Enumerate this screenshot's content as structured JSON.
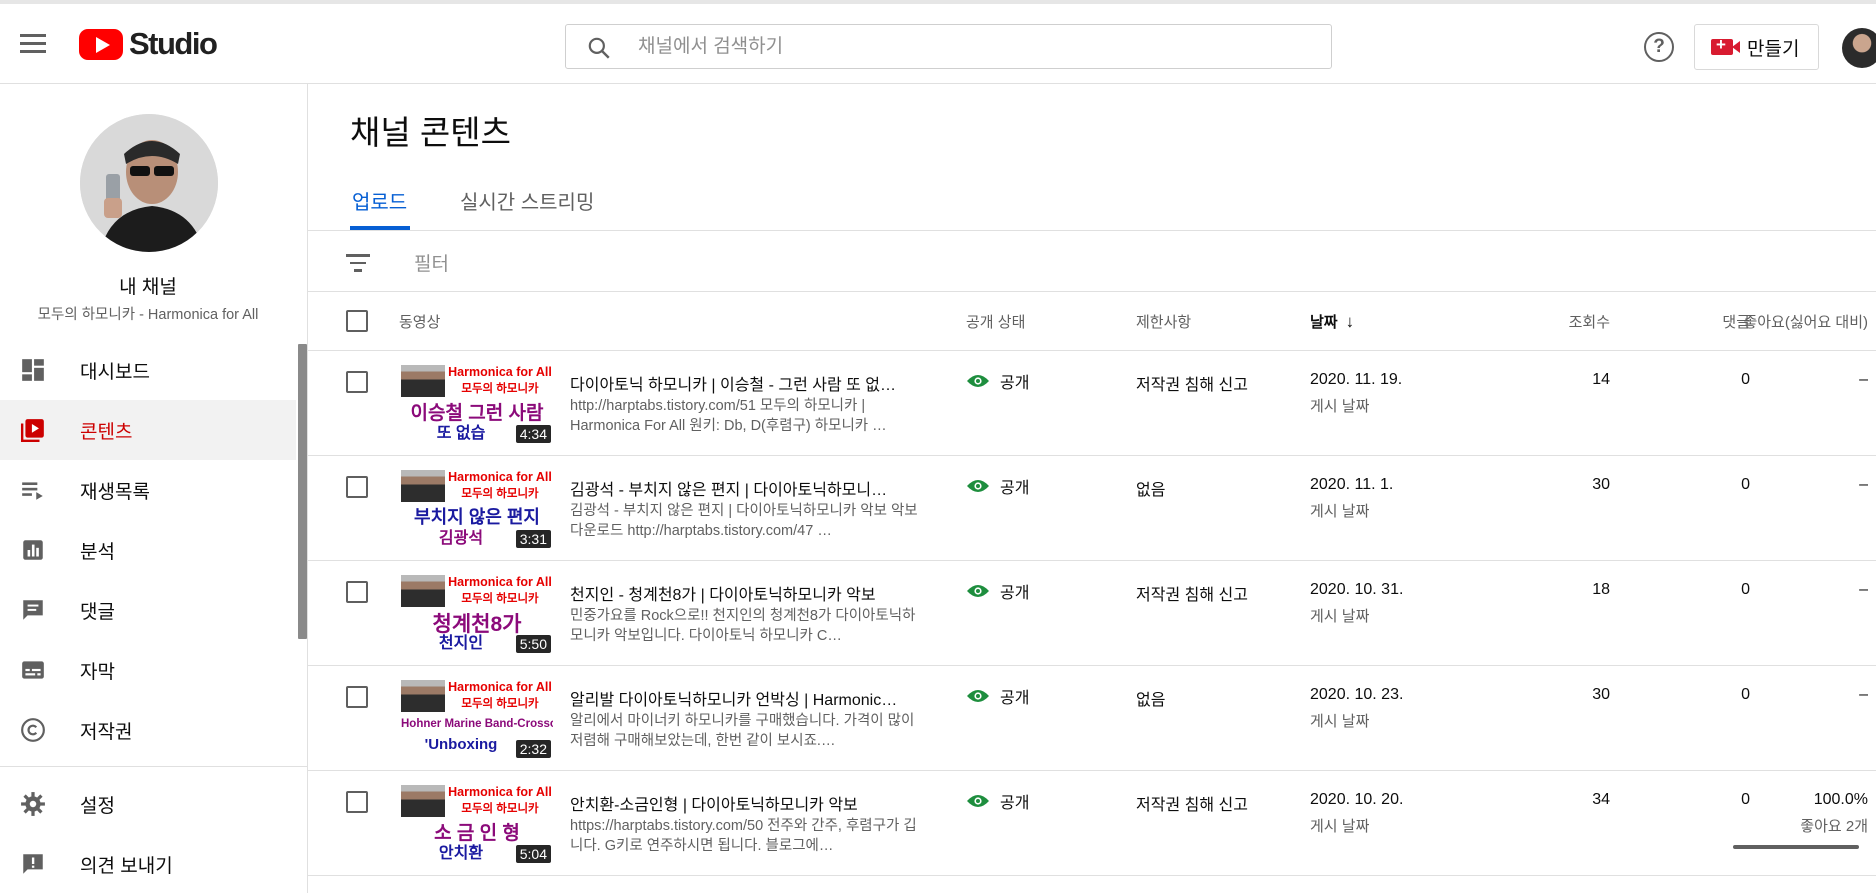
{
  "header": {
    "logo_text": "Studio",
    "search_placeholder": "채널에서 검색하기",
    "create_label": "만들기"
  },
  "sidebar": {
    "channel_title": "내 채널",
    "channel_name": "모두의 하모니카 - Harmonica for All",
    "items": [
      {
        "label": "대시보드",
        "icon": "dashboard-icon"
      },
      {
        "label": "콘텐츠",
        "icon": "content-icon",
        "active": true
      },
      {
        "label": "재생목록",
        "icon": "playlist-icon"
      },
      {
        "label": "분석",
        "icon": "analytics-icon"
      },
      {
        "label": "댓글",
        "icon": "comments-icon"
      },
      {
        "label": "자막",
        "icon": "subtitles-icon"
      },
      {
        "label": "저작권",
        "icon": "copyright-icon"
      },
      {
        "label": "설정",
        "icon": "gear-icon"
      },
      {
        "label": "의견 보내기",
        "icon": "feedback-icon"
      }
    ]
  },
  "main": {
    "title": "채널 콘텐츠",
    "tabs": [
      "업로드",
      "실시간 스트리밍"
    ],
    "filter_label": "필터",
    "columns": {
      "video": "동영상",
      "visibility": "공개 상태",
      "restrictions": "제한사항",
      "date": "날짜",
      "views": "조회수",
      "comments": "댓글",
      "likes": "좋아요(싫어요 대비)"
    },
    "rows": [
      {
        "thumb_line1": "Harmonica for All",
        "thumb_line2": "모두의 하모니카",
        "thumb_big1": "이승철 그런 사람",
        "thumb_big2": "또 없습",
        "duration": "4:34",
        "title": "다이아토닉 하모니카 | 이승철 - 그런 사람 또 없…",
        "description": "http://harptabs.tistory.com/51 모두의 하모니카 | Harmonica For All 원키: Db, D(후렴구) 하모니카 …",
        "visibility": "공개",
        "restriction": "저작권 침해 신고",
        "date": "2020. 11. 19.",
        "date_label": "게시 날짜",
        "views": "14",
        "comments": "0",
        "likes": "–",
        "likes_sub": ""
      },
      {
        "thumb_line1": "Harmonica for All",
        "thumb_line2": "모두의 하모니카",
        "thumb_big1": "부치지 않은 편지",
        "thumb_big2": "김광석",
        "duration": "3:31",
        "title": "김광석 - 부치지 않은 편지 | 다이아토닉하모니…",
        "description": "김광석 - 부치지 않은 편지 | 다이아토닉하모니카 악보 악보 다운로드 http://harptabs.tistory.com/47 …",
        "visibility": "공개",
        "restriction": "없음",
        "date": "2020. 11. 1.",
        "date_label": "게시 날짜",
        "views": "30",
        "comments": "0",
        "likes": "–",
        "likes_sub": ""
      },
      {
        "thumb_line1": "Harmonica for All",
        "thumb_line2": "모두의 하모니카",
        "thumb_big1": "청계천8가",
        "thumb_big2": "천지인",
        "duration": "5:50",
        "title": "천지인 - 청계천8가 | 다이아토닉하모니카 악보",
        "description": "민중가요를 Rock으로!! 천지인의 청계천8가 다이아토닉하모니카 악보입니다. 다이아토닉 하모니카 C…",
        "visibility": "공개",
        "restriction": "저작권 침해 신고",
        "date": "2020. 10. 31.",
        "date_label": "게시 날짜",
        "views": "18",
        "comments": "0",
        "likes": "–",
        "likes_sub": ""
      },
      {
        "thumb_line1": "Harmonica for All",
        "thumb_line2": "모두의 하모니카",
        "thumb_big1": "Hohner Marine Band-Crossover",
        "thumb_big2": "'Unboxing",
        "duration": "2:32",
        "title": "알리발 다이아토닉하모니카 언박싱 | Harmonic…",
        "description": "알리에서 마이너키 하모니카를 구매했습니다. 가격이 많이 저렴해 구매해보았는데, 한번 같이 보시죠.…",
        "visibility": "공개",
        "restriction": "없음",
        "date": "2020. 10. 23.",
        "date_label": "게시 날짜",
        "views": "30",
        "comments": "0",
        "likes": "–",
        "likes_sub": ""
      },
      {
        "thumb_line1": "Harmonica for All",
        "thumb_line2": "모두의 하모니카",
        "thumb_big1": "소 금 인 형",
        "thumb_big2": "안치환",
        "duration": "5:04",
        "title": "안치환-소금인형 | 다이아토닉하모니카 악보",
        "description": "https://harptabs.tistory.com/50 전주와 간주, 후렴구가 깁니다. G키로 연주하시면 됩니다. 블로그에…",
        "visibility": "공개",
        "restriction": "저작권 침해 신고",
        "date": "2020. 10. 20.",
        "date_label": "게시 날짜",
        "views": "34",
        "comments": "0",
        "likes": "100.0%",
        "likes_sub": "좋아요 2개",
        "like_ratio": 1.0
      }
    ]
  },
  "colors": {
    "accent": "#065fd4",
    "brand_red": "#ff0000",
    "active_nav": "#cc0000",
    "visibility_green": "#1e8e3e"
  }
}
